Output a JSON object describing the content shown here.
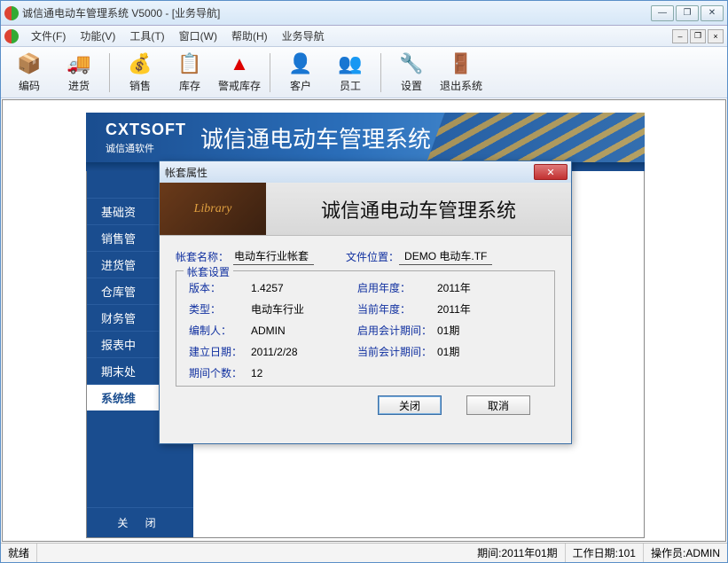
{
  "window": {
    "title": "诚信通电动车管理系统 V5000 - [业务导航]"
  },
  "menu": {
    "file": "文件(F)",
    "func": "功能(V)",
    "tools": "工具(T)",
    "window": "窗口(W)",
    "help": "帮助(H)",
    "nav": "业务导航"
  },
  "toolbar": {
    "code": "编码",
    "purchase": "进货",
    "sales": "销售",
    "stock": "库存",
    "warn": "警戒库存",
    "customer": "客户",
    "staff": "员工",
    "settings": "设置",
    "exit": "退出系统"
  },
  "nav": {
    "logo": "CXTSOFT",
    "logo_sub": "诚信通软件",
    "title": "诚信通电动车管理系统",
    "items": [
      "基础资",
      "销售管",
      "进货管",
      "仓库管",
      "财务管",
      "报表中",
      "期末处",
      "系统维"
    ],
    "close": "关   闭"
  },
  "dialog": {
    "title": "帐套属性",
    "banner_title": "诚信通电动车管理系统",
    "banner_img_text": "Library",
    "name_label": "帐套名称：",
    "name_value": "电动车行业帐套",
    "path_label": "文件位置：",
    "path_value": "DEMO 电动车.TF",
    "fieldset_legend": "帐套设置",
    "rows": {
      "version_l": "版本：",
      "version_v": "1.4257",
      "enable_year_l": "启用年度：",
      "enable_year_v": "2011年",
      "type_l": "类型：",
      "type_v": "电动车行业",
      "curr_year_l": "当前年度：",
      "curr_year_v": "2011年",
      "author_l": "编制人：",
      "author_v": "ADMIN",
      "enable_period_l": "启用会计期间：",
      "enable_period_v": "01期",
      "create_date_l": "建立日期：",
      "create_date_v": "2011/2/28",
      "curr_period_l": "当前会计期间：",
      "curr_period_v": "01期",
      "period_count_l": "期间个数：",
      "period_count_v": "12"
    },
    "close_btn": "关闭",
    "cancel_btn": "取消"
  },
  "statusbar": {
    "ready": "就绪",
    "period": "期间:2011年01期",
    "workday": "工作日期:101",
    "operator": "操作员:ADMIN"
  }
}
